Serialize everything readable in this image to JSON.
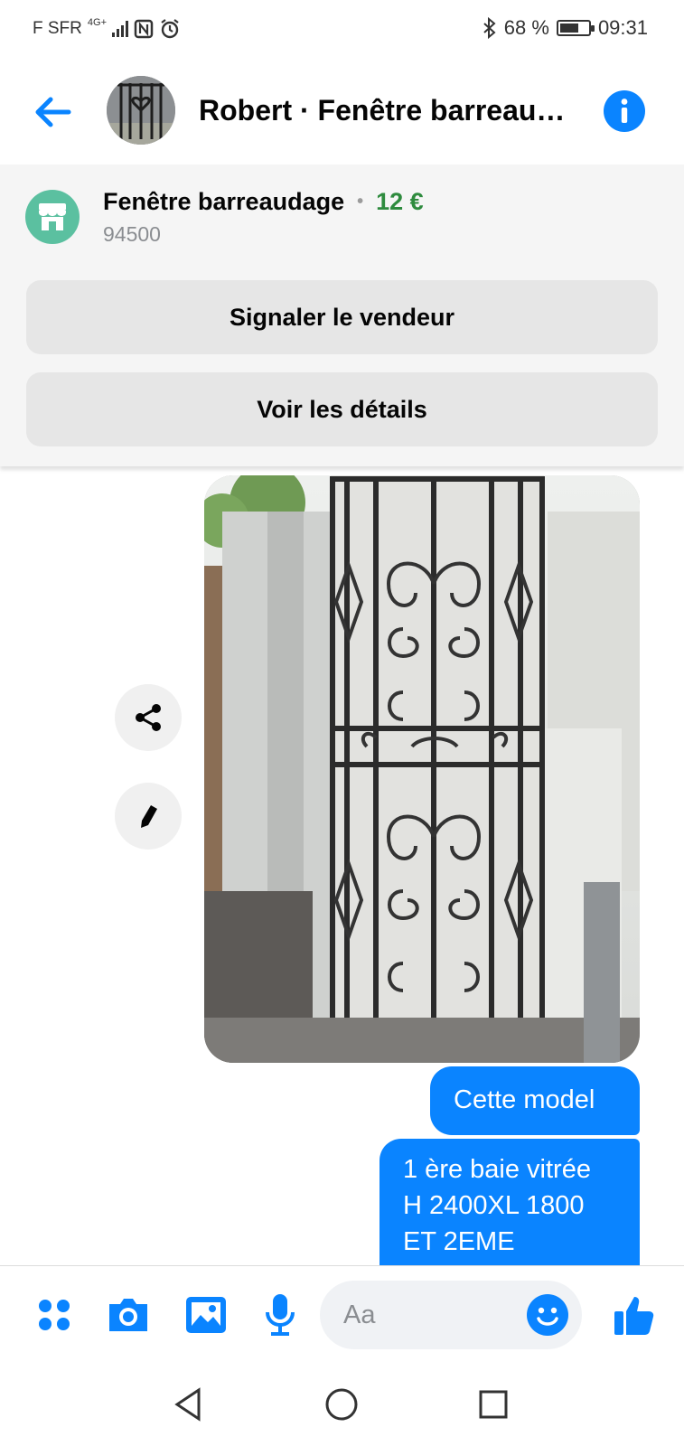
{
  "status_bar": {
    "carrier": "F SFR",
    "network": "4G+",
    "battery_percent": "68 %",
    "battery_level": 0.68,
    "time": "09:31"
  },
  "header": {
    "title": "Robert · Fenêtre barreaudage",
    "back_icon": "arrow-left-icon",
    "info_icon": "info-icon"
  },
  "product": {
    "title": "Fenêtre barreaudage",
    "separator": "•",
    "price": "12 €",
    "postal_code": "94500",
    "report_button": "Signaler le vendeur",
    "details_button": "Voir les détails"
  },
  "messages": [
    {
      "from": "me",
      "text": "Cette model"
    },
    {
      "from": "me",
      "text": "1 ère baie vitrée\nH 2400XL 1800\nET 2EME"
    }
  ],
  "composer": {
    "placeholder": "Aa",
    "icons": [
      "menu-dots-icon",
      "camera-icon",
      "image-icon",
      "microphone-icon",
      "emoji-icon",
      "thumbs-up-icon"
    ]
  },
  "colors": {
    "accent": "#0a84ff",
    "price": "#2e8b3e",
    "shop_badge": "#5bc0a0"
  }
}
